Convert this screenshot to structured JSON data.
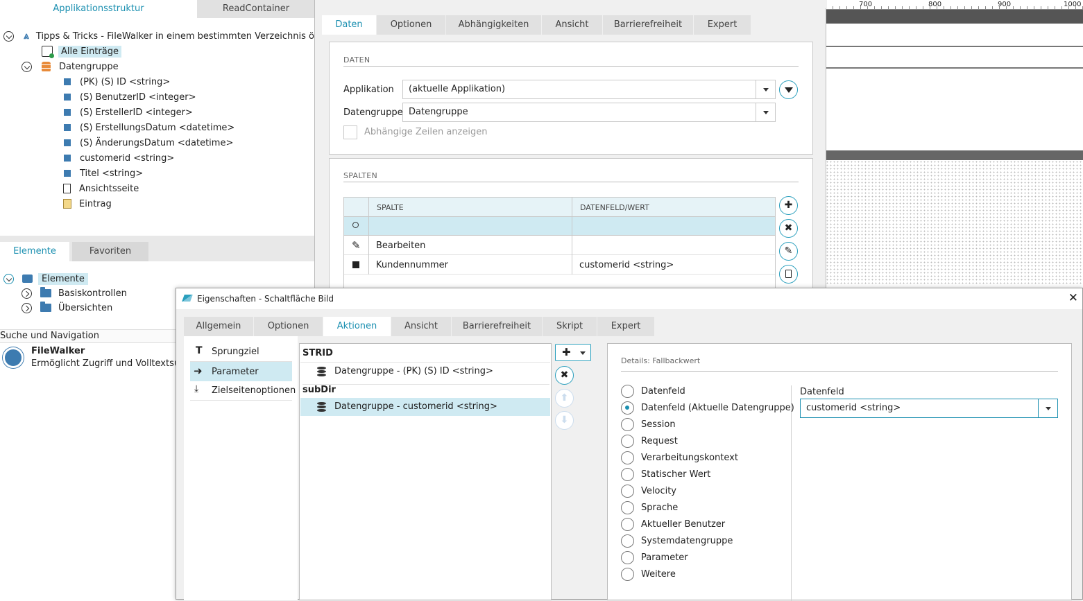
{
  "left_panel": {
    "tabs": [
      "Applikationsstruktur",
      "ReadContainer"
    ],
    "tree": {
      "root": "Tipps & Tricks - FileWalker in einem bestimmten Verzeichnis öffnen",
      "all_entries": "Alle Einträge",
      "datagroup": "Datengruppe",
      "fields": [
        "(PK) (S) ID <string>",
        "(S) BenutzerID <integer>",
        "(S) ErstellerID <integer>",
        "(S) ErstellungsDatum <datetime>",
        "(S) ÄnderungsDatum <datetime>",
        "customerid <string>",
        "Titel <string>"
      ],
      "view_page": "Ansichtsseite",
      "entry": "Eintrag"
    },
    "element_tabs": [
      "Elemente",
      "Favoriten"
    ],
    "elements_tree": {
      "root": "Elemente",
      "items": [
        "Basiskontrollen",
        "Übersichten"
      ]
    },
    "search_nav": {
      "title": "Suche und Navigation",
      "item_title": "FileWalker",
      "item_desc": "Ermöglicht Zugriff und Volltextsuche"
    }
  },
  "ruler": {
    "labels": [
      "700",
      "800",
      "900",
      "1000"
    ]
  },
  "back_dialog": {
    "tabs": [
      "Daten",
      "Optionen",
      "Abhängigkeiten",
      "Ansicht",
      "Barrierefreiheit",
      "Expert"
    ],
    "active_tab": "Daten",
    "daten_section": {
      "title": "DATEN",
      "app_label": "Applikation",
      "app_value": "(aktuelle Applikation)",
      "dg_label": "Datengruppe",
      "dg_value": "Datengruppe",
      "checkbox_label": "Abhängige Zeilen anzeigen"
    },
    "spalten_section": {
      "title": "SPALTEN",
      "headers": [
        "SPALTE",
        "DATENFELD/WERT"
      ],
      "rows": [
        {
          "spalte": "Bearbeiten",
          "wert": ""
        },
        {
          "spalte": "Kundennummer",
          "wert": "customerid <string>"
        }
      ]
    }
  },
  "front_dialog": {
    "title": "Eigenschaften - Schaltfläche Bild",
    "tabs": [
      "Allgemein",
      "Optionen",
      "Aktionen",
      "Ansicht",
      "Barrierefreiheit",
      "Skript",
      "Expert"
    ],
    "active_tab": "Aktionen",
    "side_nav": [
      "Sprungziel",
      "Parameter",
      "Zielseitenoptionen"
    ],
    "params": {
      "group1": "STRID",
      "item1": "Datengruppe - (PK) (S) ID <string>",
      "group2": "subDir",
      "item2": "Datengruppe - customerid <string>"
    },
    "details": {
      "title": "Details: Fallbackwert",
      "options": [
        "Datenfeld",
        "Datenfeld (Aktuelle Datengruppe)",
        "Session",
        "Request",
        "Verarbeitungskontext",
        "Statischer Wert",
        "Velocity",
        "Sprache",
        "Aktueller Benutzer",
        "Systemdatengruppe",
        "Parameter",
        "Weitere"
      ],
      "selected_index": 1,
      "field_label": "Datenfeld",
      "field_value": "customerid <string>"
    }
  },
  "colors": {
    "accent": "#1a8fb0",
    "selection": "#cfeaf2",
    "tab_bg": "#e1e1e1"
  }
}
